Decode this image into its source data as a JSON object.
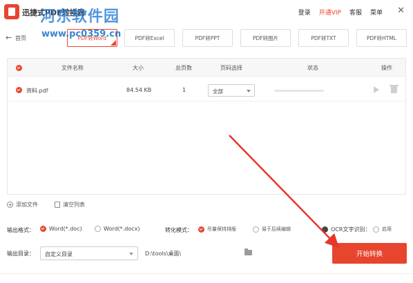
{
  "window": {
    "title": "迅捷式PDF转换器",
    "watermark_text": "河东软件园",
    "watermark_url": "www.pc0359.cn"
  },
  "top_nav": {
    "login": "登录",
    "vip": "开通VIP",
    "service": "客服",
    "menu": "菜单",
    "close": "✕"
  },
  "toolbar": {
    "back": "←",
    "home": "首页"
  },
  "tabs": [
    {
      "label": "PDF转Word"
    },
    {
      "label": "PDF转Excel"
    },
    {
      "label": "PDF转PPT"
    },
    {
      "label": "PDF转图片"
    },
    {
      "label": "PDF转TXT"
    },
    {
      "label": "PDF转HTML"
    }
  ],
  "table": {
    "headers": {
      "filename": "文件名称",
      "size": "大小",
      "pages": "总页数",
      "page_select": "页码选择",
      "status": "状态",
      "action": "操作"
    },
    "rows": [
      {
        "filename": "资料.pdf",
        "size": "84.54 KB",
        "pages": "1",
        "page_select": "全部",
        "progress": 0
      }
    ]
  },
  "list_actions": {
    "add_file": "添加文件",
    "clear_list": "清空列表"
  },
  "options": {
    "output_format_label": "输出格式：",
    "format_doc": "Word(*.doc)",
    "format_docx": "Word(*.docx)",
    "convert_mode_label": "转化模式：",
    "mode_keep_layout": "尽量保持排版",
    "mode_easy_edit": "易于后续编辑",
    "ocr_label": "OCR文字识别：",
    "ocr_enable": "启用",
    "output_dir_label": "输出目录：",
    "output_dir_select": "自定义目录",
    "output_path": "D:\\tools\\桌面\\"
  },
  "start_button": "开始转换",
  "colors": {
    "accent": "#e8452f",
    "annotation_arrow": "#e8352a"
  }
}
